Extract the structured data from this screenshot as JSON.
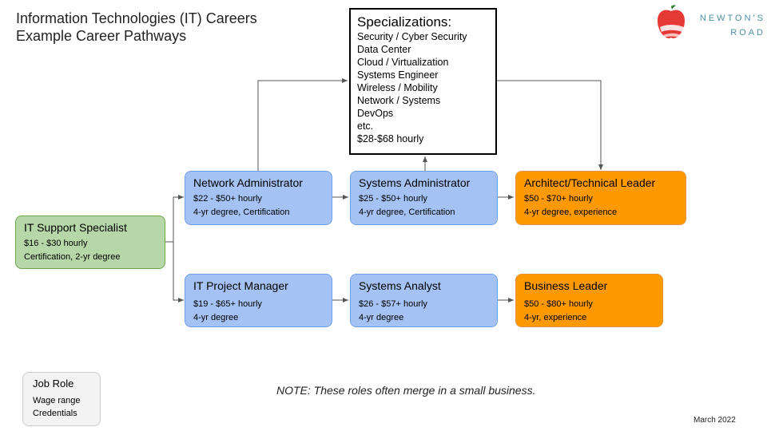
{
  "title": {
    "line1": "Information Technologies (IT) Careers",
    "line2": "Example Career Pathways"
  },
  "logo": {
    "icon": "apple-icon",
    "line1": "NEWTON'S",
    "line2": "ROAD"
  },
  "specializations": {
    "heading": "Specializations:",
    "items": [
      "Security / Cyber Security",
      "Data Center",
      "Cloud / Virtualization",
      "Systems Engineer",
      "Wireless / Mobility",
      "Network / Systems",
      "DevOps",
      "etc.",
      "$28-$68 hourly"
    ]
  },
  "roles": {
    "it_support": {
      "name": "IT Support Specialist",
      "wage": "$16 - $30 hourly",
      "credentials": "Certification, 2-yr degree"
    },
    "network_admin": {
      "name": "Network Administrator",
      "wage": "$22 - $50+ hourly",
      "credentials": "4-yr degree, Certification"
    },
    "systems_admin": {
      "name": "Systems Administrator",
      "wage": "$25 - $50+ hourly",
      "credentials": "4-yr degree, Certification"
    },
    "architect": {
      "name": "Architect/Technical Leader",
      "wage": "$50 - $70+ hourly",
      "credentials": "4-yr degree, experience"
    },
    "project_manager": {
      "name": "IT Project Manager",
      "wage": "$19 - $65+ hourly",
      "credentials": "4-yr degree"
    },
    "systems_analyst": {
      "name": "Systems Analyst",
      "wage": "$26 - $57+ hourly",
      "credentials": "4-yr degree"
    },
    "business_leader": {
      "name": "Business Leader",
      "wage": "$50 - $80+ hourly",
      "credentials": "4-yr, experience"
    }
  },
  "legend": {
    "name": "Job Role",
    "wage": "Wage range",
    "credentials": "Credentials"
  },
  "note": "NOTE: These roles often merge in a small business.",
  "date": "March 2022",
  "colors": {
    "entry": "#b6d7a8",
    "mid": "#a4c2f4",
    "senior": "#ff9900",
    "legend": "#f3f3f3"
  }
}
